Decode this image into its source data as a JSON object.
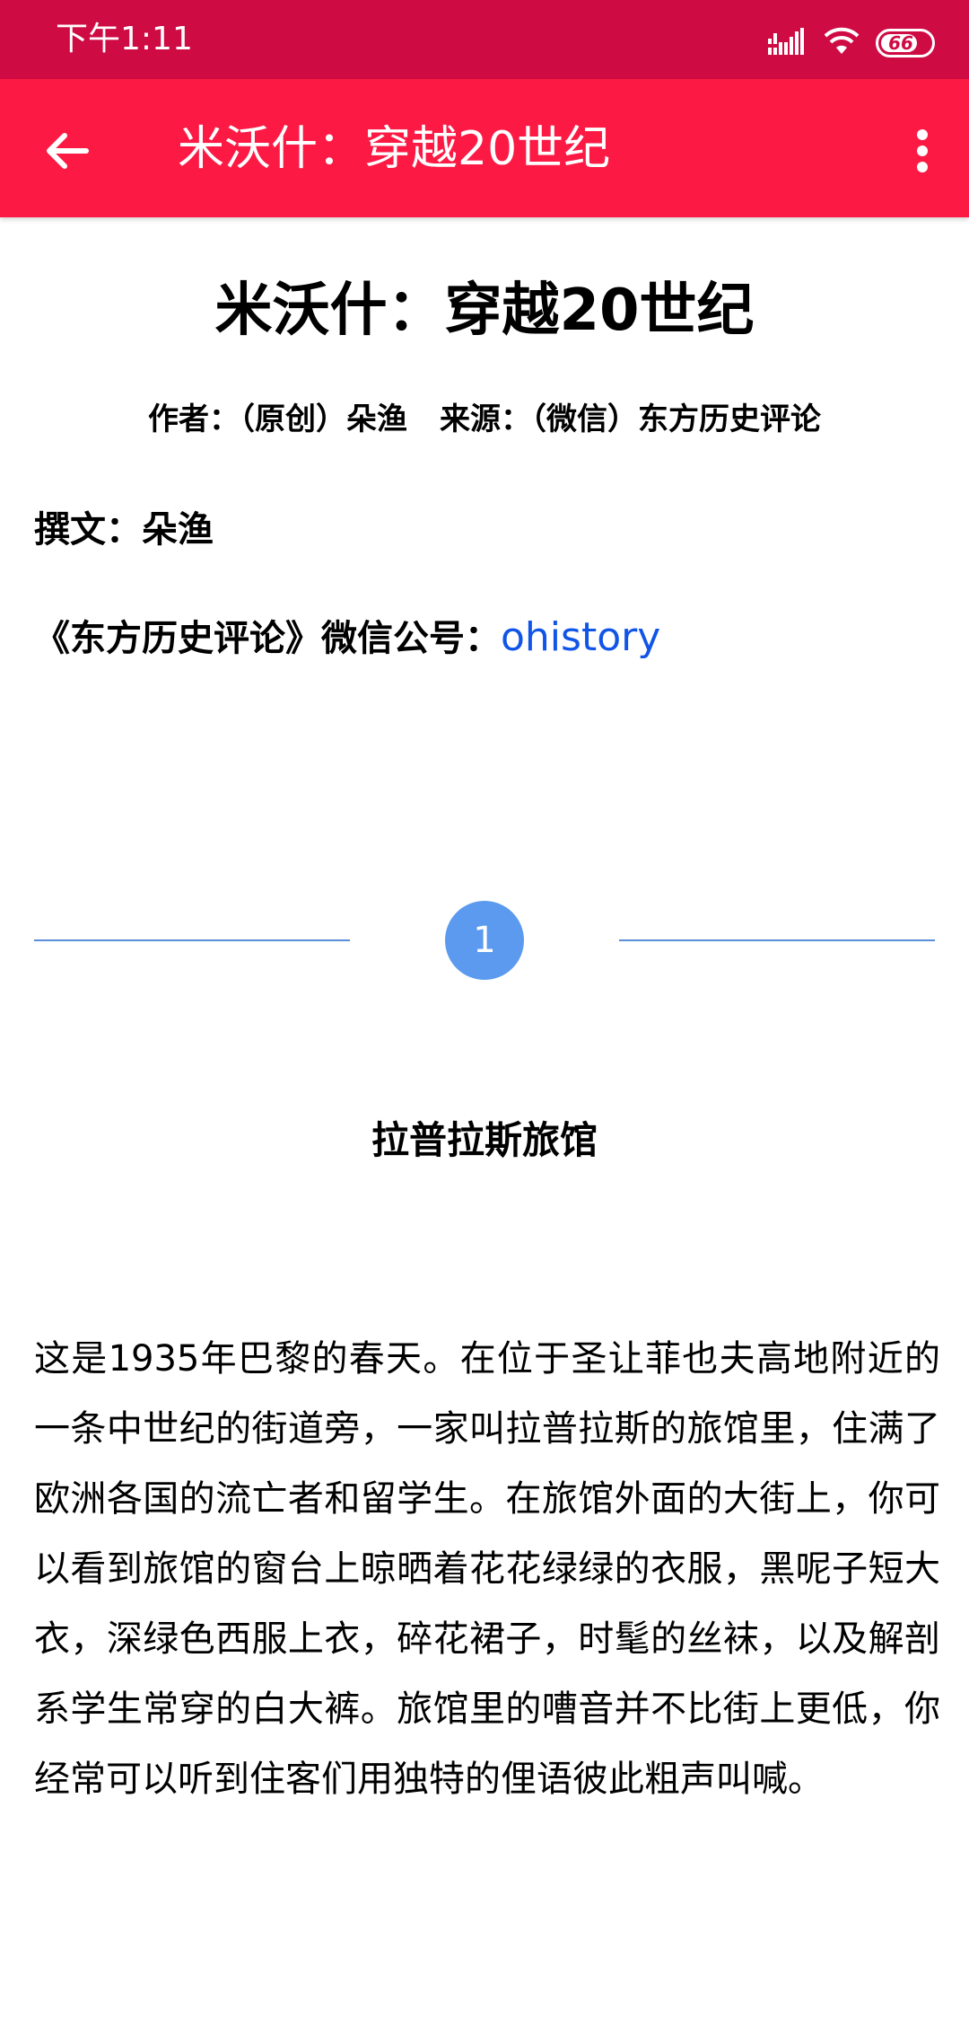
{
  "status_bar": {
    "time": "下午1:11",
    "battery_level": "66",
    "icons": [
      "signal-icon",
      "wifi-icon",
      "battery-icon"
    ]
  },
  "app_bar": {
    "title": "米沃什：穿越20世纪",
    "back_icon": "arrow-left-icon",
    "more_icon": "more-vertical-icon",
    "color": "#fc1a45"
  },
  "article": {
    "title": "米沃什：穿越20世纪",
    "author_label": "作者：（原创）朵渔",
    "source_label": "来源：（微信）东方历史评论",
    "writer_line": "撰文：朵渔",
    "account_label": "《东方历史评论》微信公号：",
    "account_link": "ohistory",
    "section_number": "1",
    "section_heading": "拉普拉斯旅馆",
    "paragraph": "这是1935年巴黎的春天。在位于圣让菲也夫高地附近的一条中世纪的街道旁，一家叫拉普拉斯的旅馆里，住满了欧洲各国的流亡者和留学生。在旅馆外面的大街上，你可以看到旅馆的窗台上晾晒着花花绿绿的衣服，黑呢子短大衣，深绿色西服上衣，碎花裙子，时髦的丝袜，以及解剖系学生常穿的白大裤。旅馆里的嘈音并不比街上更低，你经常可以听到住客们用独特的俚语彼此粗声叫喊。"
  }
}
